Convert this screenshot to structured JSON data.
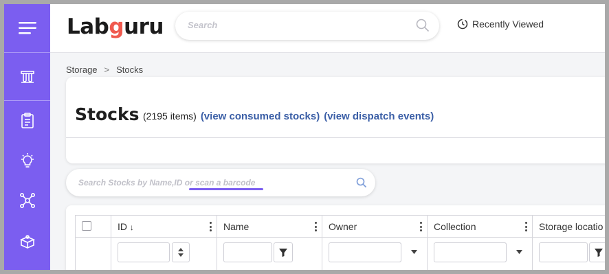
{
  "app": {
    "name": "Labguru"
  },
  "header": {
    "logo_text_pre": "Lab",
    "logo_text_g": "g",
    "logo_text_post": "uru",
    "search_placeholder": "Search",
    "recently_viewed_label": "Recently Viewed"
  },
  "sidebar": {
    "items": [
      {
        "name": "menu-icon"
      },
      {
        "name": "test-tubes-icon"
      },
      {
        "name": "clipboard-icon"
      },
      {
        "name": "lightbulb-icon"
      },
      {
        "name": "network-icon"
      },
      {
        "name": "box-icon"
      }
    ],
    "color": "#7b5ef0"
  },
  "breadcrumb": {
    "root": "Storage",
    "separator": ">",
    "current": "Stocks"
  },
  "page": {
    "title": "Stocks",
    "count": "(2195 items)",
    "link_consumed": "(view consumed stocks)",
    "link_dispatch": "(view dispatch events)"
  },
  "stock_search": {
    "placeholder": "Search Stocks by Name,ID or scan a barcode"
  },
  "table": {
    "columns": [
      {
        "label": "ID",
        "sort": "↓"
      },
      {
        "label": "Name"
      },
      {
        "label": "Owner"
      },
      {
        "label": "Collection"
      },
      {
        "label": "Storage locatio"
      }
    ]
  },
  "colors": {
    "accent": "#7b5ef0",
    "link": "#3a5ea6"
  }
}
